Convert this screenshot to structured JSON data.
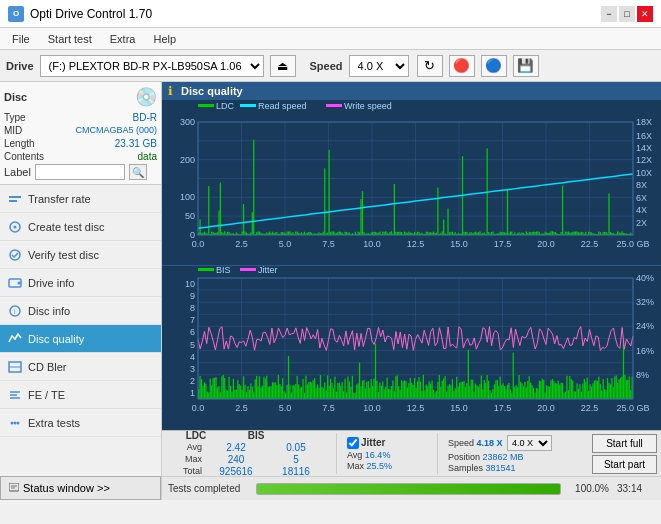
{
  "titleBar": {
    "title": "Opti Drive Control 1.70",
    "minimizeBtn": "−",
    "maximizeBtn": "□",
    "closeBtn": "✕"
  },
  "menuBar": {
    "items": [
      "File",
      "Start test",
      "Extra",
      "Help"
    ]
  },
  "driveBar": {
    "driveLabel": "Drive",
    "driveValue": "(F:)  PLEXTOR BD-R   PX-LB950SA 1.06",
    "speedLabel": "Speed",
    "speedValue": "4.0 X"
  },
  "disc": {
    "label": "Disc",
    "typeLabel": "Type",
    "typeValue": "BD-R",
    "midLabel": "MID",
    "midValue": "CMCMAGBA5 (000)",
    "lengthLabel": "Length",
    "lengthValue": "23.31 GB",
    "contentsLabel": "Contents",
    "contentsValue": "data",
    "labelLabel": "Label",
    "labelValue": ""
  },
  "navItems": [
    {
      "id": "transfer-rate",
      "label": "Transfer rate"
    },
    {
      "id": "create-test-disc",
      "label": "Create test disc"
    },
    {
      "id": "verify-test-disc",
      "label": "Verify test disc"
    },
    {
      "id": "drive-info",
      "label": "Drive info"
    },
    {
      "id": "disc-info",
      "label": "Disc info"
    },
    {
      "id": "disc-quality",
      "label": "Disc quality",
      "active": true
    },
    {
      "id": "cd-bler",
      "label": "CD Bler"
    },
    {
      "id": "fe-te",
      "label": "FE / TE"
    },
    {
      "id": "extra-tests",
      "label": "Extra tests"
    }
  ],
  "statusWindow": {
    "label": "Status window >>"
  },
  "chart": {
    "title": "Disc quality",
    "upperLegend": [
      {
        "label": "LDC",
        "color": "#00cc00"
      },
      {
        "label": "Read speed",
        "color": "#00ffff"
      },
      {
        "label": "Write speed",
        "color": "#ff66ff"
      }
    ],
    "lowerLegend": [
      {
        "label": "BIS",
        "color": "#00cc00"
      },
      {
        "label": "Jitter",
        "color": "#ff66ff"
      }
    ],
    "upperYMax": 300,
    "upperYLabels": [
      "300",
      "200",
      "100",
      "50",
      "0"
    ],
    "upperY2Labels": [
      "18X",
      "16X",
      "14X",
      "12X",
      "10X",
      "8X",
      "6X",
      "4X",
      "2X"
    ],
    "lowerYMax": 10,
    "lowerYLabels": [
      "10",
      "9",
      "8",
      "7",
      "6",
      "5",
      "4",
      "3",
      "2",
      "1"
    ],
    "lowerY2Labels": [
      "40%",
      "32%",
      "24%",
      "16%",
      "8%"
    ],
    "xLabels": [
      "0.0",
      "2.5",
      "5.0",
      "7.5",
      "10.0",
      "12.5",
      "15.0",
      "17.5",
      "20.0",
      "22.5",
      "25.0 GB"
    ]
  },
  "statsBar": {
    "columns": [
      {
        "header": "LDC",
        "avg": "2.42",
        "max": "240",
        "total": "925616"
      },
      {
        "header": "BIS",
        "avg": "0.05",
        "max": "5",
        "total": "18116"
      }
    ],
    "jitterLabel": "Jitter",
    "jitterAvg": "16.4%",
    "jitterMax": "25.5%",
    "speedLabel": "Speed",
    "speedValue": "4.18 X",
    "speedSelectValue": "4.0 X",
    "positionLabel": "Position",
    "positionValue": "23862 MB",
    "samplesLabel": "Samples",
    "samplesValue": "381541",
    "startFullBtn": "Start full",
    "startPartBtn": "Start part"
  },
  "progressBar": {
    "statusText": "Tests completed",
    "percent": 100,
    "percentLabel": "100.0%",
    "time": "33:14"
  },
  "icons": {
    "disc": "💿",
    "gear": "⚙",
    "check": "✓",
    "arrow": "▶",
    "eject": "⏏",
    "refresh": "↻",
    "save": "💾",
    "chart": "📊"
  }
}
